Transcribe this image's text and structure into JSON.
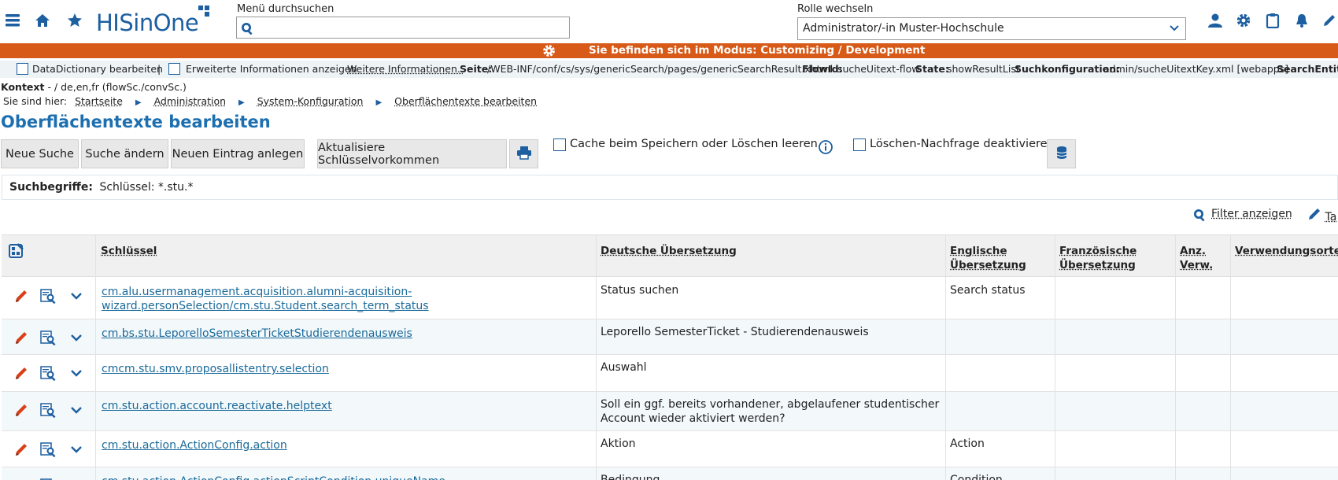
{
  "header": {
    "logo_text": "HISinOne",
    "menu_search_label": "Menü durchsuchen",
    "role_label": "Rolle wechseln",
    "role_value": "Administrator/-in Muster-Hochschule"
  },
  "mode_banner": "Sie befinden sich im Modus: Customizing / Development",
  "infobar": {
    "datadict": "DataDictionary bearbeiten",
    "separator": "|",
    "extended": "Erweiterte Informationen anzeigen",
    "more": "Weitere Informationen..",
    "seite_label": "Seite:",
    "seite_value": "/WEB-INF/conf/cs/sys/genericSearch/pages/genericSearchResult.xhtml",
    "flowid_label": "FlowId:",
    "flowid_value": "sucheUitext-flow",
    "state_label": "State:",
    "state_value": "showResultList",
    "suchkonf_label": "Suchkonfiguration:",
    "suchkonf_value": "admin/sucheUitextKey.xml [webapps]",
    "searchentity_label": "SearchEntity:"
  },
  "kontext_label": "Kontext",
  "kontext_value": "- / de,en,fr (flowSc./convSc.)",
  "breadcrumb": {
    "prefix": "Sie sind hier:",
    "items": [
      "Startseite",
      "Administration",
      "System-Konfiguration",
      "Oberflächentexte bearbeiten"
    ]
  },
  "page_title": "Oberflächentexte bearbeiten",
  "toolbar": {
    "new_search": "Neue Suche",
    "edit_search": "Suche ändern",
    "new_entry": "Neuen Eintrag anlegen",
    "refresh_keys": "Aktualisiere Schlüsselvorkommen",
    "cache_label": "Cache beim Speichern oder Löschen leeren",
    "delete_confirm_label": "Löschen-Nachfrage deaktivieren"
  },
  "search_terms": {
    "label": "Suchbegriffe:",
    "value": "Schlüssel: *.stu.*"
  },
  "filter_label": "Filter anzeigen",
  "tab_fragment": "Ta",
  "table": {
    "headers": {
      "key": "Schlüssel",
      "de": "Deutsche Übersetzung",
      "en_1": "Englische",
      "en_2": "Übersetzung",
      "fr_1": "Französische",
      "fr_2": "Übersetzung",
      "count_1": "Anz.",
      "count_2": "Verw.",
      "usage": "Verwendungsorte"
    },
    "rows": [
      {
        "key_1": "cm.alu.usermanagement.acquisition.alumni-acquisition-",
        "key_2": "wizard.personSelection/cm.stu.Student.search_term_status",
        "de_1": "Status suchen",
        "de_2": "",
        "en": "Search status"
      },
      {
        "key_1": "cm.bs.stu.LeporelloSemesterTicketStudierendenausweis",
        "key_2": "",
        "de_1": "Leporello SemesterTicket - Studierendenausweis",
        "de_2": "",
        "en": ""
      },
      {
        "key_1": "cmcm.stu.smv.proposallistentry.selection",
        "key_2": "",
        "de_1": "Auswahl",
        "de_2": "",
        "en": ""
      },
      {
        "key_1": "cm.stu.action.account.reactivate.helptext",
        "key_2": "",
        "de_1": "Soll ein ggf. bereits vorhandener, abgelaufener studentischer",
        "de_2": "Account wieder aktiviert werden?",
        "en": ""
      },
      {
        "key_1": "cm.stu.action.ActionConfig.action",
        "key_2": "",
        "de_1": "Aktion",
        "de_2": "",
        "en": "Action"
      },
      {
        "key_1": "cm.stu.action.ActionConfig.actionScriptCondition.uniqueName",
        "key_2": "",
        "de_1": "Bedingung",
        "de_2": "",
        "en": "Condition"
      }
    ]
  },
  "colors": {
    "brand_blue": "#1d5fa0",
    "mode_orange": "#d75a18",
    "edit_red": "#d9401a"
  }
}
